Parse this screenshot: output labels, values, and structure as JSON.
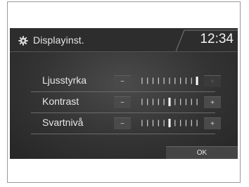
{
  "header": {
    "icon": "gear-icon",
    "title": "Displayinst.",
    "clock": "12:34"
  },
  "settings": [
    {
      "label": "Ljusstyrka",
      "minus": "−",
      "plus": "+",
      "level": 11,
      "steps": 11,
      "plus_enabled": false
    },
    {
      "label": "Kontrast",
      "minus": "−",
      "plus": "+",
      "level": 6,
      "steps": 11,
      "plus_enabled": true
    },
    {
      "label": "Svartnivå",
      "minus": "−",
      "plus": "+",
      "level": 6,
      "steps": 11,
      "plus_enabled": true
    }
  ],
  "ok_label": "OK",
  "colors": {
    "screen_bg": "#2d2d2d",
    "text": "#e8e8e8",
    "tick": "#cfcfcf",
    "marker": "#ffffff"
  }
}
